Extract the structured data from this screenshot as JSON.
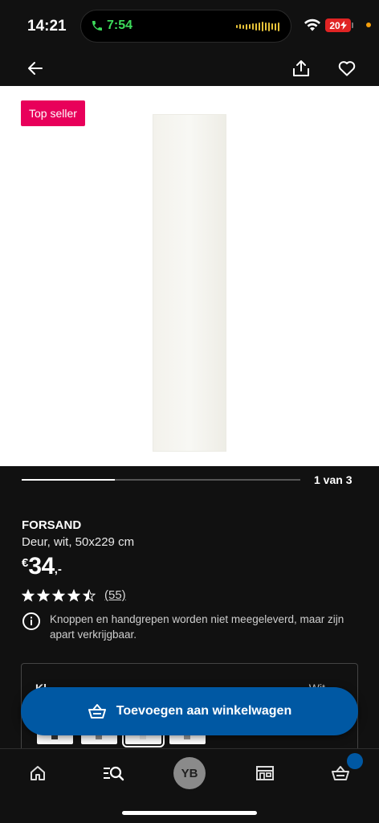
{
  "status_bar": {
    "time": "14:21",
    "call_time": "7:54",
    "battery": "20"
  },
  "header": {
    "back_icon": "arrow-left-icon",
    "share_icon": "share-icon",
    "favorite_icon": "heart-icon"
  },
  "product_image": {
    "badge": "Top seller"
  },
  "pager": {
    "label": "1 van 3",
    "progress": 0.333
  },
  "product": {
    "name": "FORSAND",
    "description": "Deur, wit, 50x229 cm",
    "price_currency": "€",
    "price_amount": "34",
    "price_decimals": ",-",
    "rating_stars": 4.5,
    "rating_count": "(55)",
    "info_text": "Knoppen en handgrepen worden niet meegeleverd, maar zijn apart verkrijgbaar."
  },
  "color_selector": {
    "label": "Kl",
    "value": "Wit"
  },
  "cart_button": {
    "label": "Toevoegen aan winkelwagen"
  },
  "bottom_nav": {
    "avatar_initials": "YB",
    "items": [
      "home-icon",
      "search-icon",
      "profile-avatar",
      "store-icon",
      "cart-icon"
    ]
  },
  "colors": {
    "brand_blue": "#0058a3",
    "badge_pink": "#e8005a",
    "background": "#111111"
  }
}
